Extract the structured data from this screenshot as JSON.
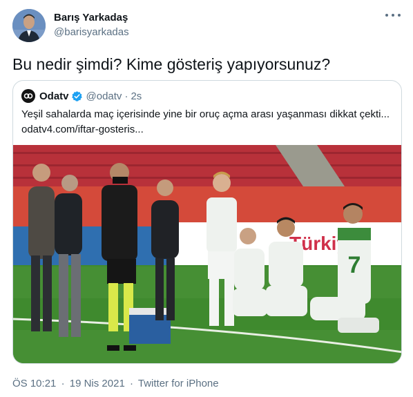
{
  "author": {
    "name": "Barış Yarkadaş",
    "handle": "@barisyarkadas"
  },
  "tweet": {
    "text": "Bu nedir şimdi? Kime gösteriş yapıyorsunuz?"
  },
  "quoted": {
    "name": "Odatv",
    "handle": "@odatv",
    "separator": "·",
    "time": "2s",
    "text": "Yeşil sahalarda maç içerisinde yine bir oruç açma arası yaşanması dikkat çekti...",
    "link": "odatv4.com/iftar-gosteris..."
  },
  "meta": {
    "time": "ÖS 10:21",
    "separator": "·",
    "date": "19 Nis 2021",
    "source": "Twitter for iPhone"
  },
  "icons": {
    "more": "more-horizontal-icon",
    "verified": "verified-badge-icon"
  },
  "colors": {
    "text": "#0f1419",
    "secondary": "#5b7083",
    "verified": "#1da1f2",
    "border": "#cfd9de"
  }
}
